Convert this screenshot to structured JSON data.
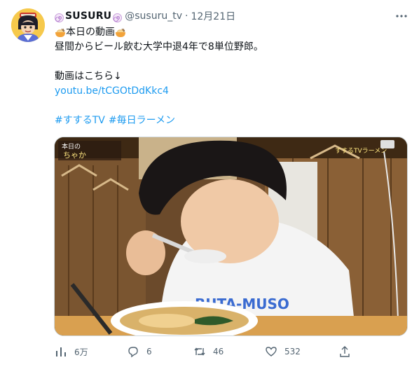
{
  "user": {
    "display_name": "SUSURU",
    "handle": "@susuru_tv",
    "separator": "·",
    "date": "12月21日"
  },
  "tweet": {
    "line1": "本日の動画",
    "line2": "昼間からビール飲む大学中退4年で8単位野郎。",
    "line3": "動画はこちら↓",
    "link": "youtu.be/tCGOtDdKkc4",
    "hashtag1": "#すするTV",
    "hashtag2": "#毎日ラーメン"
  },
  "actions": {
    "views": "6万",
    "replies": "6",
    "retweets": "46",
    "likes": "532"
  },
  "icons": {
    "avatar": "avatar-icon",
    "swirl": "naruto-swirl-icon",
    "ramen": "ramen-bowl-icon",
    "more": "more-icon",
    "views": "views-chart-icon",
    "reply": "reply-icon",
    "retweet": "retweet-icon",
    "like": "heart-icon",
    "share": "share-icon"
  },
  "colors": {
    "link": "#1d9bf0",
    "secondary_text": "#536471",
    "primary_text": "#0f1419",
    "swirl": "#c9a0dc"
  }
}
